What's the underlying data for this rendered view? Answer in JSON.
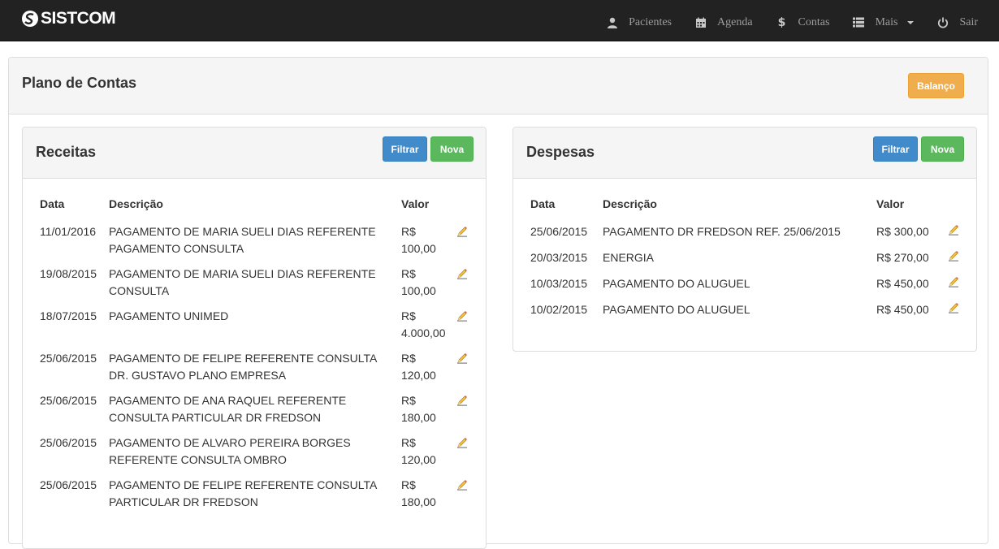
{
  "app": {
    "brand": "SISTCOM"
  },
  "nav": [
    {
      "label": "Pacientes",
      "icon": "user-icon"
    },
    {
      "label": "Agenda",
      "icon": "calendar-icon"
    },
    {
      "label": "Contas",
      "icon": "dollar-icon"
    },
    {
      "label": "Mais",
      "icon": "list-icon"
    },
    {
      "label": "Sair",
      "icon": "power-icon"
    }
  ],
  "page": {
    "title": "Plano de Contas",
    "balanco_label": "Balanço"
  },
  "receitas": {
    "title": "Receitas",
    "filtrar_label": "Filtrar",
    "nova_label": "Nova",
    "headers": {
      "data": "Data",
      "descricao": "Descrição",
      "valor": "Valor"
    },
    "rows": [
      {
        "data": "11/01/2016",
        "desc1": "PAGAMENTO DE MARIA SUELI DIAS REFERENTE",
        "desc2": "PAGAMENTO CONSULTA",
        "val1": "R$",
        "val2": "100,00"
      },
      {
        "data": "19/08/2015",
        "desc1": "PAGAMENTO DE MARIA SUELI DIAS REFERENTE",
        "desc2": "CONSULTA",
        "val1": "R$",
        "val2": "100,00"
      },
      {
        "data": "18/07/2015",
        "desc1": "PAGAMENTO UNIMED",
        "desc2": "",
        "val1": "R$",
        "val2": "4.000,00"
      },
      {
        "data": "25/06/2015",
        "desc1": "PAGAMENTO DE FELIPE REFERENTE CONSULTA",
        "desc2": "DR. GUSTAVO PLANO EMPRESA",
        "val1": "R$",
        "val2": "120,00"
      },
      {
        "data": "25/06/2015",
        "desc1": "PAGAMENTO DE ANA RAQUEL REFERENTE",
        "desc2": "CONSULTA PARTICULAR DR FREDSON",
        "val1": "R$",
        "val2": "180,00"
      },
      {
        "data": "25/06/2015",
        "desc1": "PAGAMENTO DE ALVARO PEREIRA BORGES",
        "desc2": "REFERENTE CONSULTA OMBRO",
        "val1": "R$",
        "val2": "120,00"
      },
      {
        "data": "25/06/2015",
        "desc1": "PAGAMENTO DE FELIPE REFERENTE CONSULTA",
        "desc2": "PARTICULAR DR FREDSON",
        "val1": "R$",
        "val2": "180,00"
      }
    ]
  },
  "despesas": {
    "title": "Despesas",
    "filtrar_label": "Filtrar",
    "nova_label": "Nova",
    "headers": {
      "data": "Data",
      "descricao": "Descrição",
      "valor": "Valor"
    },
    "rows": [
      {
        "data": "25/06/2015",
        "desc": "PAGAMENTO DR FREDSON REF. 25/06/2015",
        "valor": "R$ 300,00"
      },
      {
        "data": "20/03/2015",
        "desc": "ENERGIA",
        "valor": "R$ 270,00"
      },
      {
        "data": "10/03/2015",
        "desc": "PAGAMENTO DO ALUGUEL",
        "valor": "R$ 450,00"
      },
      {
        "data": "10/02/2015",
        "desc": "PAGAMENTO DO ALUGUEL",
        "valor": "R$ 450,00"
      }
    ]
  },
  "colors": {
    "navbar": "#222222",
    "primary": "#428bca",
    "success": "#5cb85c",
    "warning": "#f0ad4e"
  }
}
